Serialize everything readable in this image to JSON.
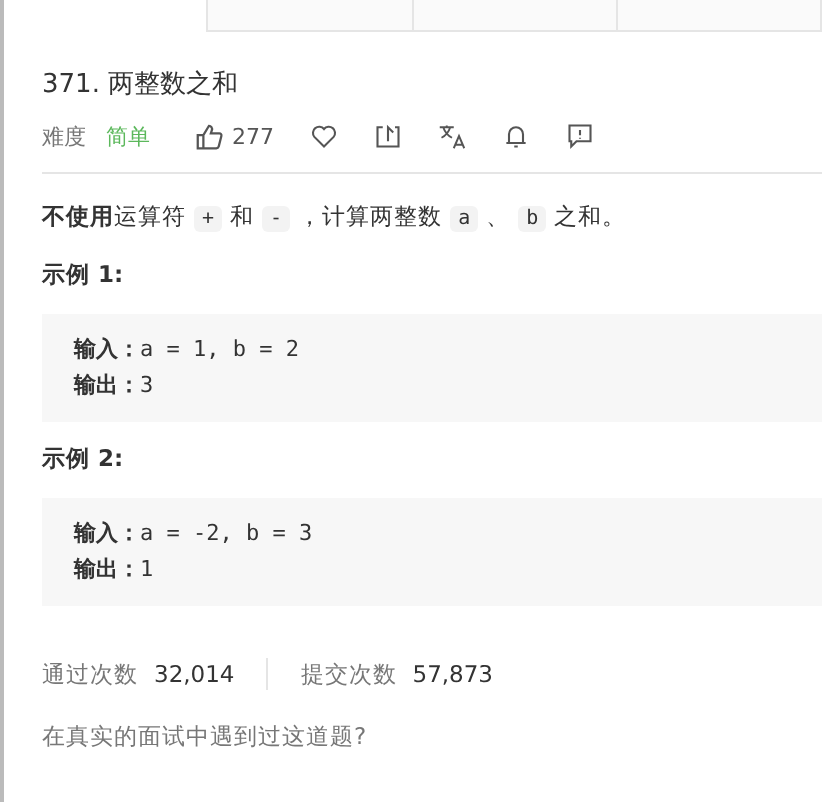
{
  "tabs": [
    {
      "selected": true
    },
    {
      "selected": false
    },
    {
      "selected": false
    },
    {
      "selected": false
    }
  ],
  "problem": {
    "title": "371. 两整数之和",
    "difficulty_label": "难度",
    "difficulty": "简单",
    "likes": "277"
  },
  "description": {
    "bold": "不使用",
    "parts": [
      {
        "kind": "text",
        "text": "运算符"
      },
      {
        "kind": "code",
        "text": "+"
      },
      {
        "kind": "text",
        "text": "和"
      },
      {
        "kind": "code",
        "text": "-"
      },
      {
        "kind": "text",
        "text": "，计算两整数"
      },
      {
        "kind": "code",
        "text": "a"
      },
      {
        "kind": "text",
        "text": "、"
      },
      {
        "kind": "code",
        "text": "b"
      },
      {
        "kind": "text",
        "text": "之和。"
      }
    ]
  },
  "examples": [
    {
      "heading": "示例 1:",
      "lines": [
        {
          "label": "输入：",
          "value": "a = 1, b = 2"
        },
        {
          "label": "输出：",
          "value": "3"
        }
      ]
    },
    {
      "heading": "示例 2:",
      "lines": [
        {
          "label": "输入：",
          "value": "a = -2, b = 3"
        },
        {
          "label": "输出：",
          "value": "1"
        }
      ]
    }
  ],
  "stats": [
    {
      "label": "通过次数",
      "value": "32,014"
    },
    {
      "label": "提交次数",
      "value": "57,873"
    }
  ],
  "footer": "在真实的面试中遇到过这道题?"
}
